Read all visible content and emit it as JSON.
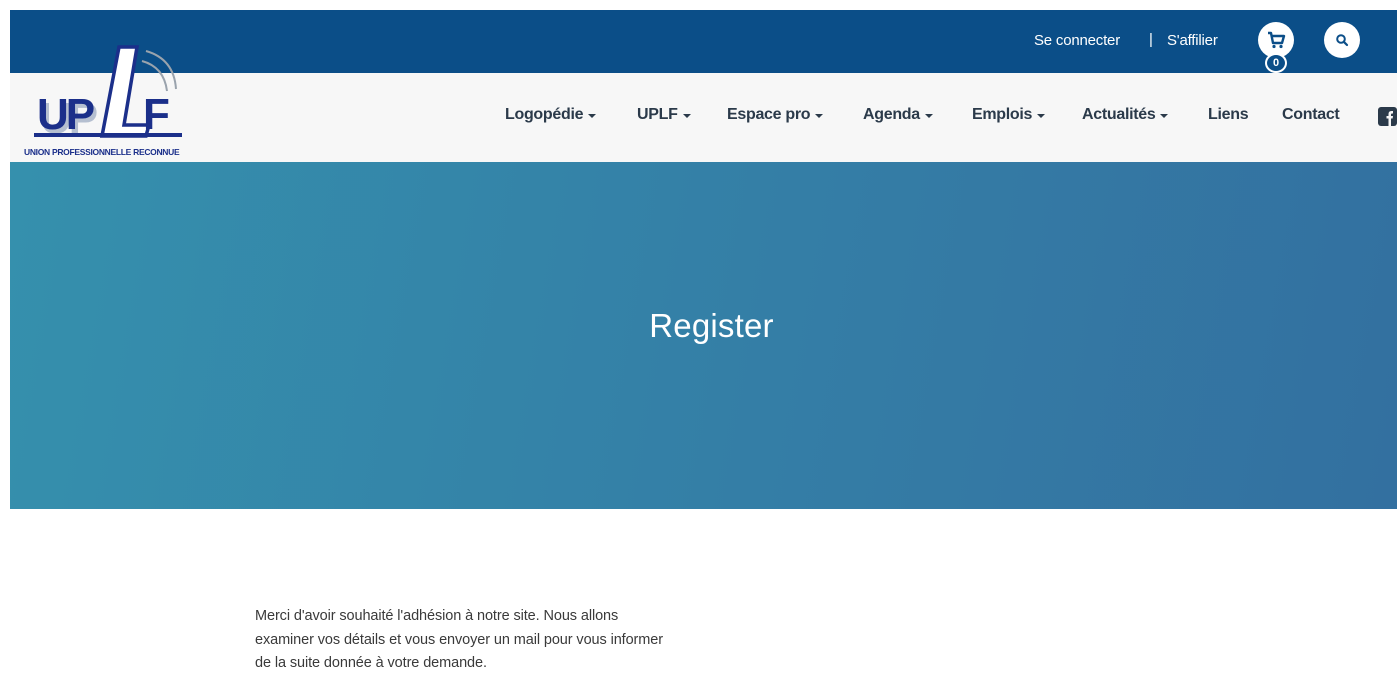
{
  "header": {
    "login_label": "Se connecter",
    "separator": "|",
    "affiliate_label": "S'affilier",
    "cart_count": "0",
    "icons": [
      "cart-icon",
      "search-icon",
      "facebook-icon"
    ],
    "colors": {
      "topbar": "#0b4e88",
      "navbar": "#f7f7f7"
    }
  },
  "logo": {
    "text": "UPLF",
    "tagline": "UNION PROFESSIONNELLE RECONNUE"
  },
  "nav": {
    "items": [
      {
        "label": "Logopédie",
        "has_dropdown": true
      },
      {
        "label": "UPLF",
        "has_dropdown": true
      },
      {
        "label": "Espace pro",
        "has_dropdown": true
      },
      {
        "label": "Agenda",
        "has_dropdown": true
      },
      {
        "label": "Emplois",
        "has_dropdown": true
      },
      {
        "label": "Actualités",
        "has_dropdown": true
      },
      {
        "label": "Liens",
        "has_dropdown": false
      },
      {
        "label": "Contact",
        "has_dropdown": false
      }
    ]
  },
  "hero": {
    "title": "Register",
    "gradient": [
      "#3590ad",
      "#3370a0"
    ]
  },
  "content": {
    "lines": [
      "Merci d'avoir souhaité l'adhésion à notre site. Nous allons",
      "examiner vos détails et vous envoyer un mail pour vous informer",
      "de la suite donnée à votre demande."
    ]
  }
}
